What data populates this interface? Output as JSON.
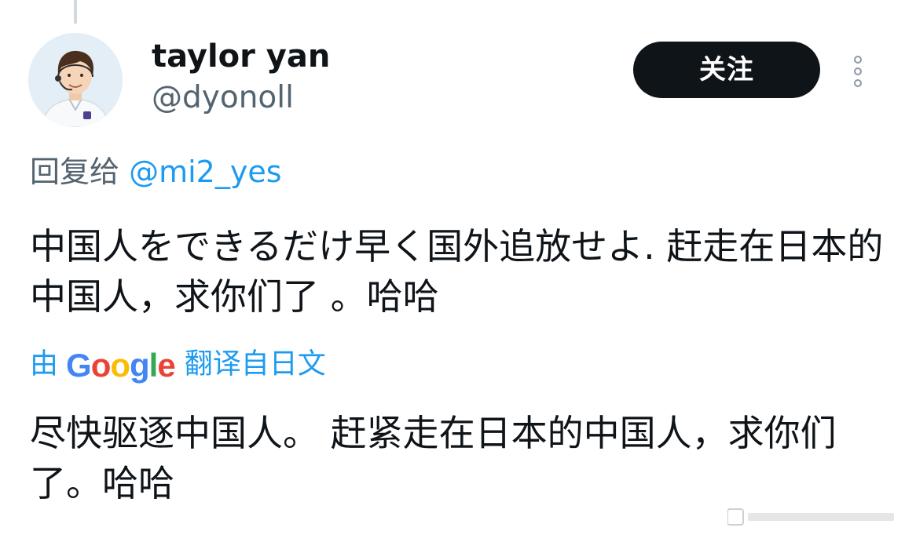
{
  "author": {
    "name": "taylor yan",
    "handle": "@dyonoll"
  },
  "actions": {
    "follow_label": "关注"
  },
  "reply": {
    "prefix": "回复给",
    "mention": "@mi2_yes"
  },
  "tweet": {
    "text": "中国人をできるだけ早く国外追放せよ. 赶走在日本的中国人，求你们了 。哈哈"
  },
  "translation": {
    "by_label": "由",
    "provider": "Google",
    "from_label": "翻译自日文",
    "text": "尽快驱逐中国人。 赶紧走在日本的中国人，求你们了。哈哈"
  },
  "icons": {
    "avatar": "avatar-person",
    "more": "more-vertical-icon"
  },
  "colors": {
    "accent": "#1d9bf0",
    "secondary_text": "#536471",
    "follow_button": "#0f1419"
  }
}
